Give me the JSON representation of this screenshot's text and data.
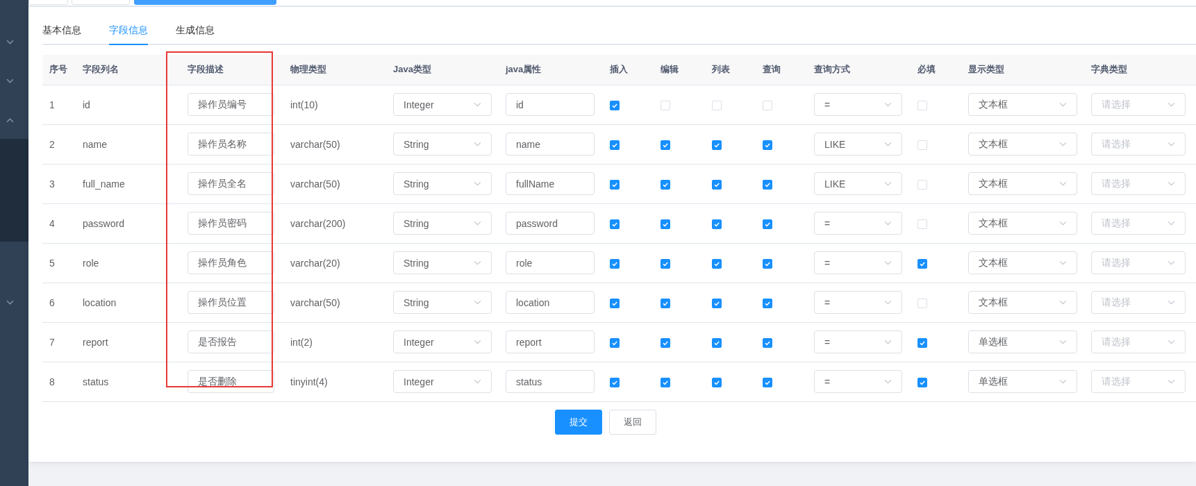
{
  "tabs": [
    {
      "label": "基本信息",
      "selected": false
    },
    {
      "label": "字段信息",
      "selected": true
    },
    {
      "label": "生成信息",
      "selected": false
    }
  ],
  "table": {
    "columns": [
      "序号",
      "字段列名",
      "字段描述",
      "物理类型",
      "Java类型",
      "java属性",
      "插入",
      "编辑",
      "列表",
      "查询",
      "查询方式",
      "必填",
      "显示类型",
      "字典类型"
    ],
    "rows": [
      {
        "index": "1",
        "column_name": "id",
        "description": "操作员编号",
        "physical_type": "int(10)",
        "java_type": "Integer",
        "java_field": "id",
        "insert": true,
        "edit": false,
        "list": false,
        "query": false,
        "query_type": "=",
        "required": false,
        "display_type": "文本框",
        "dict_type_placeholder": "请选择"
      },
      {
        "index": "2",
        "column_name": "name",
        "description": "操作员名称",
        "physical_type": "varchar(50)",
        "java_type": "String",
        "java_field": "name",
        "insert": true,
        "edit": true,
        "list": true,
        "query": true,
        "query_type": "LIKE",
        "required": false,
        "display_type": "文本框",
        "dict_type_placeholder": "请选择"
      },
      {
        "index": "3",
        "column_name": "full_name",
        "description": "操作员全名",
        "physical_type": "varchar(50)",
        "java_type": "String",
        "java_field": "fullName",
        "insert": true,
        "edit": true,
        "list": true,
        "query": true,
        "query_type": "LIKE",
        "required": false,
        "display_type": "文本框",
        "dict_type_placeholder": "请选择"
      },
      {
        "index": "4",
        "column_name": "password",
        "description": "操作员密码",
        "physical_type": "varchar(200)",
        "java_type": "String",
        "java_field": "password",
        "insert": true,
        "edit": true,
        "list": true,
        "query": true,
        "query_type": "=",
        "required": false,
        "display_type": "文本框",
        "dict_type_placeholder": "请选择"
      },
      {
        "index": "5",
        "column_name": "role",
        "description": "操作员角色",
        "physical_type": "varchar(20)",
        "java_type": "String",
        "java_field": "role",
        "insert": true,
        "edit": true,
        "list": true,
        "query": true,
        "query_type": "=",
        "required": true,
        "display_type": "文本框",
        "dict_type_placeholder": "请选择"
      },
      {
        "index": "6",
        "column_name": "location",
        "description": "操作员位置",
        "physical_type": "varchar(50)",
        "java_type": "String",
        "java_field": "location",
        "insert": true,
        "edit": true,
        "list": true,
        "query": true,
        "query_type": "=",
        "required": false,
        "display_type": "文本框",
        "dict_type_placeholder": "请选择"
      },
      {
        "index": "7",
        "column_name": "report",
        "description": "是否报告",
        "physical_type": "int(2)",
        "java_type": "Integer",
        "java_field": "report",
        "insert": true,
        "edit": true,
        "list": true,
        "query": true,
        "query_type": "=",
        "required": true,
        "display_type": "单选框",
        "dict_type_placeholder": "请选择"
      },
      {
        "index": "8",
        "column_name": "status",
        "description": "是否删除",
        "physical_type": "tinyint(4)",
        "java_type": "Integer",
        "java_field": "status",
        "insert": true,
        "edit": true,
        "list": true,
        "query": true,
        "query_type": "=",
        "required": true,
        "display_type": "单选框",
        "dict_type_placeholder": "请选择"
      }
    ]
  },
  "buttons": {
    "submit": "提交",
    "back": "返回"
  }
}
